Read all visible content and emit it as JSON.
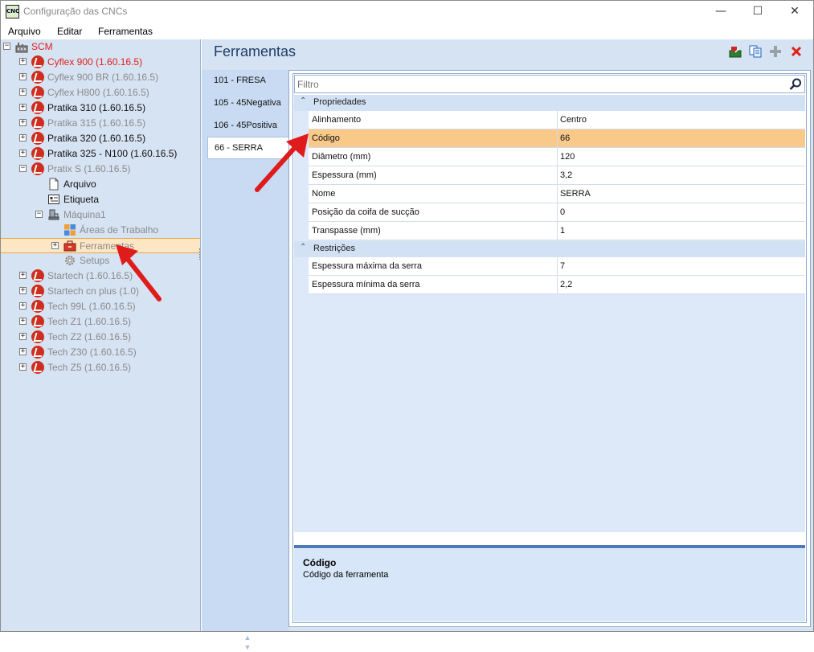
{
  "window": {
    "icon_text": "CNC",
    "title": "Configuração das CNCs",
    "minimize": "—",
    "maximize": "☐",
    "close": "✕"
  },
  "menu": [
    "Arquivo",
    "Editar",
    "Ferramentas"
  ],
  "tree": {
    "root": {
      "label": "SCM",
      "color": "#e0201a"
    },
    "items": [
      {
        "label": "Cyflex 900 (1.60.16.5)",
        "style": "red"
      },
      {
        "label": "Cyflex 900 BR (1.60.16.5)",
        "style": "gray"
      },
      {
        "label": "Cyflex H800 (1.60.16.5)",
        "style": "gray"
      },
      {
        "label": "Pratika 310 (1.60.16.5)",
        "style": "black"
      },
      {
        "label": "Pratika 315 (1.60.16.5)",
        "style": "gray"
      },
      {
        "label": "Pratika 320 (1.60.16.5)",
        "style": "black"
      },
      {
        "label": "Pratika 325 - N100 (1.60.16.5)",
        "style": "black"
      },
      {
        "label": "Pratix S (1.60.16.5)",
        "style": "gray"
      },
      {
        "label": "Arquivo",
        "style": "black"
      },
      {
        "label": "Etiqueta",
        "style": "black"
      },
      {
        "label": "Máquina1",
        "style": "gray"
      },
      {
        "label": "Áreas de Trabalho",
        "style": "gray"
      },
      {
        "label": "Ferramentas",
        "style": "gray"
      },
      {
        "label": "Setups",
        "style": "gray"
      },
      {
        "label": "Startech (1.60.16.5)",
        "style": "gray"
      },
      {
        "label": "Startech cn plus (1.0)",
        "style": "gray"
      },
      {
        "label": "Tech 99L (1.60.16.5)",
        "style": "gray"
      },
      {
        "label": "Tech Z1 (1.60.16.5)",
        "style": "gray"
      },
      {
        "label": "Tech Z2 (1.60.16.5)",
        "style": "gray"
      },
      {
        "label": "Tech Z30 (1.60.16.5)",
        "style": "gray"
      },
      {
        "label": "Tech Z5 (1.60.16.5)",
        "style": "gray"
      }
    ]
  },
  "content": {
    "title": "Ferramentas",
    "toolbar": [
      "import-icon",
      "copy-icon",
      "add-icon",
      "delete-icon"
    ],
    "tabs": [
      "101 - FRESA",
      "105 - 45Negativa",
      "106 - 45Positiva",
      "66 - SERRA"
    ],
    "active_tab": "66 - SERRA",
    "filter_placeholder": "Filtro",
    "categories": [
      {
        "label": "Propriedades",
        "rows": [
          {
            "name": "Alinhamento",
            "value": "Centro"
          },
          {
            "name": "Código",
            "value": "66"
          },
          {
            "name": "Diâmetro (mm)",
            "value": "120"
          },
          {
            "name": "Espessura (mm)",
            "value": "3,2"
          },
          {
            "name": "Nome",
            "value": "SERRA"
          },
          {
            "name": "Posição da coifa de sucção",
            "value": "0"
          },
          {
            "name": "Transpasse (mm)",
            "value": "1"
          }
        ]
      },
      {
        "label": "Restrições",
        "rows": [
          {
            "name": "Espessura máxima da serra",
            "value": "7"
          },
          {
            "name": "Espessura mínima da serra",
            "value": "2,2"
          }
        ]
      }
    ],
    "selected_row": "Código",
    "description": {
      "title": "Código",
      "text": "Código da ferramenta"
    }
  },
  "colors": {
    "accent_selection": "#f9c98a",
    "tree_selection": "#fde6c4",
    "panel_bg": "#d6e3f3",
    "annotation_arrow": "#e01b1b"
  }
}
